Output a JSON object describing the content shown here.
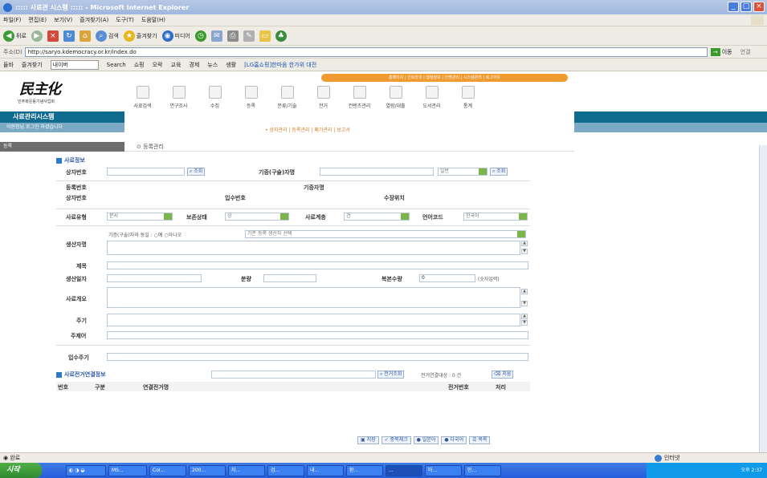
{
  "window": {
    "title": "::::: 사료관 시스템 ::::: - Microsoft Internet Explorer",
    "menu": [
      "파일(F)",
      "편집(E)",
      "보기(V)",
      "즐겨찾기(A)",
      "도구(T)",
      "도움말(H)"
    ],
    "toolbar": [
      "뒤로",
      "검색",
      "즐겨찾기",
      "미디어"
    ],
    "address_label": "주소(D)",
    "address": "http://saryo.kdemocracy.or.kr/index.do",
    "go_label": "이동",
    "links_label": "연결",
    "linksbar": [
      "들바",
      "즐겨찾기",
      "내이버",
      "Search",
      "쇼핑",
      "오락",
      "교육",
      "경제",
      "뉴스",
      "생활",
      "[LG홈쇼핑]한마음 한가위 대전"
    ]
  },
  "site": {
    "logo_text": "民主化",
    "logo_sub": "민주화운동기념사업회",
    "system_name": "사료관리시스템",
    "login_notice": "이현정님 로그인 하셨습니다",
    "top_nav": "홈페이지 | 인트라넷 | 행정정보 | 인명관리 | 시스템관리 | 로그아웃",
    "icon_menu": [
      "사료검색",
      "연구조사",
      "수집",
      "등록",
      "분류/기술",
      "전거",
      "컨텐츠관리",
      "열람/대출",
      "도서관리",
      "통계"
    ],
    "sub_nav": "• 상자관리 | 등록관리 | 폐기관리 | 보고서",
    "left_crumb": "등록",
    "crumb": "등록관리"
  },
  "form": {
    "section1": "사료정보",
    "box_no_label": "상자번호",
    "search_btn": "조회",
    "donor_label": "기증(구술)자명",
    "normal_select": "일반",
    "reg_no_label": "등록번호",
    "donor_name_label": "기증자명",
    "box_no2_label": "상자번호",
    "accession_no_label": "입수번호",
    "storage_loc_label": "수장위치",
    "type_label": "사료유형",
    "type_value": "문서",
    "condition_label": "보존상태",
    "condition_value": "상",
    "level_label": "사료계층",
    "level_value": "건",
    "lang_label": "언어코드",
    "lang_value": "한국어",
    "creator_label": "생산자명",
    "creator_same": "기증(구술)자와 동일 :",
    "yes": "예",
    "no": "아니오",
    "creator_select": "기존 등록 생산자 선택",
    "title_label": "제목",
    "date_label": "생산일자",
    "qty_label": "분량",
    "copies_label": "복본수량",
    "copies_value": "0",
    "copies_hint": "(숫자입력)",
    "summary_label": "사료개요",
    "note_label": "주기",
    "keyword_label": "주제어",
    "input_note_label": "입수주기",
    "section2": "사료전거연결정보",
    "authority_search_btn": "전거조회",
    "link_count": "전거연결대상 : 0 건",
    "delete_btn": "지움",
    "cols": [
      "번호",
      "구분",
      "연결전거명",
      "전거번호",
      "처리"
    ],
    "bottom_buttons": [
      "저장",
      "중복체크",
      "일본어",
      "다국어",
      "목록"
    ]
  },
  "status": {
    "left": "완료",
    "zone": "인터넷"
  },
  "taskbar": {
    "start": "시작",
    "tasks": [
      "MS...",
      "Col...",
      "200...",
      "자...",
      "검...",
      "내...",
      "환...",
      "...",
      "마...",
      "민..."
    ],
    "clock": "오후 2:37"
  }
}
